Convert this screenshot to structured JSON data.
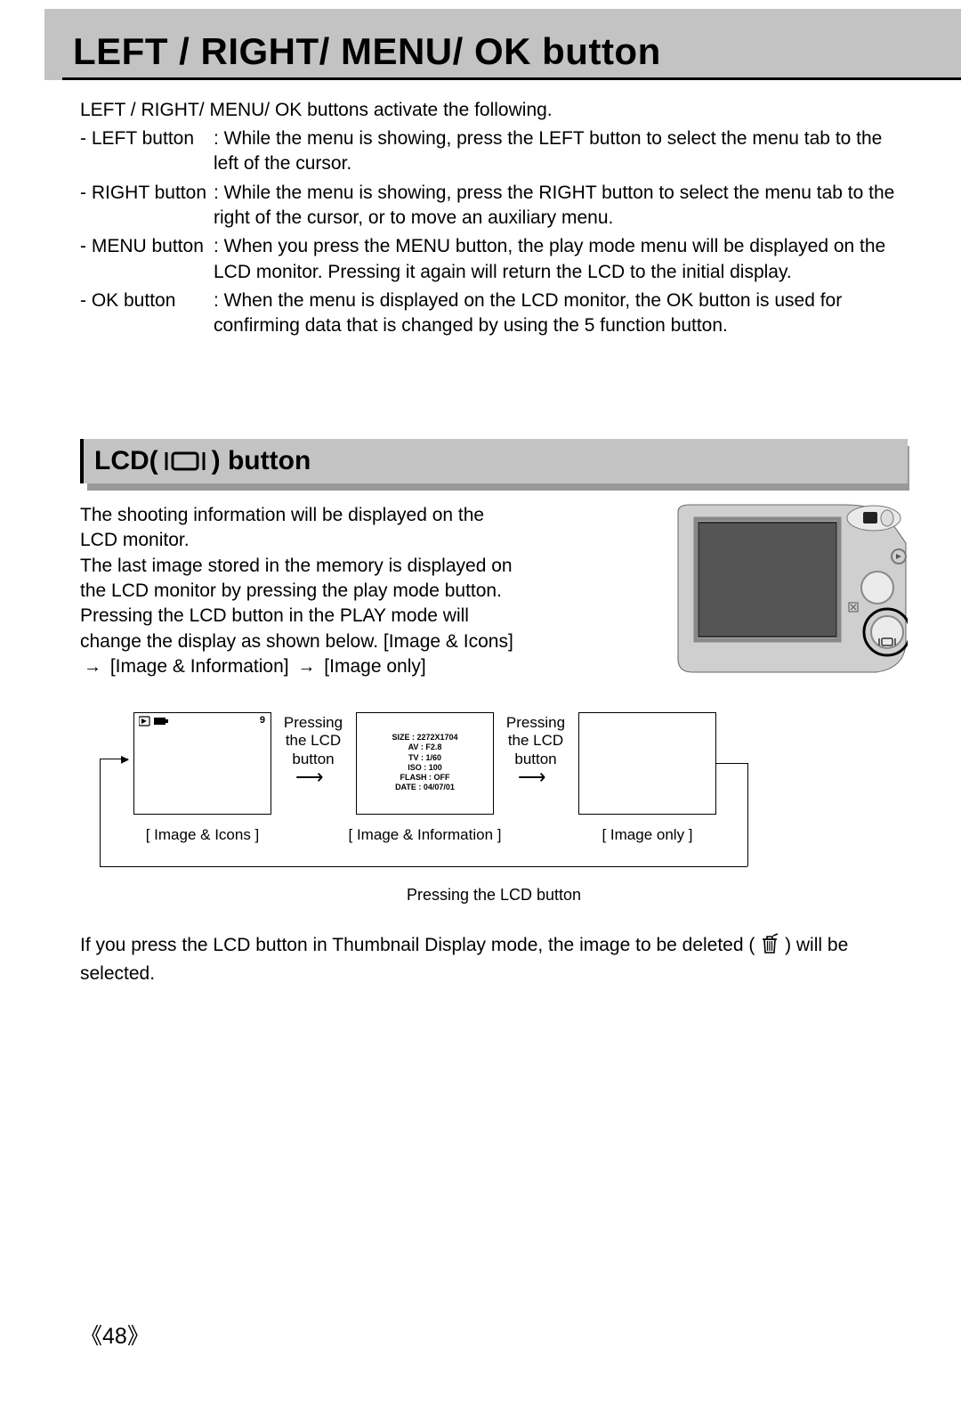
{
  "title": "LEFT / RIGHT/ MENU/ OK button",
  "intro": "LEFT / RIGHT/ MENU/ OK buttons activate the following.",
  "defs": [
    {
      "label": "- LEFT button",
      "desc": ": While the menu is showing, press the LEFT button to select the menu tab to the left of the cursor."
    },
    {
      "label": "- RIGHT button",
      "desc": ": While the menu is showing, press the RIGHT button to select the menu tab to the right of the cursor, or to move an auxiliary menu."
    },
    {
      "label": "- MENU button",
      "desc": ": When you press the MENU button, the play mode menu will be displayed on the LCD monitor. Pressing it again will return the LCD to the initial display."
    },
    {
      "label": "- OK button",
      "desc": ": When the menu is displayed on the LCD monitor, the OK button is used for confirming data that is changed by using the 5 function button."
    }
  ],
  "section2": {
    "prefix": "LCD(",
    "suffix": ") button",
    "icon_name": "lcd-icon"
  },
  "body2": {
    "p1": "The shooting information will be displayed on the LCD monitor.",
    "p2": "The last image stored in the memory is displayed on the LCD monitor by pressing the play mode button.",
    "p3a": "Pressing the LCD button in the PLAY mode will change the display as shown below. [Image & Icons]",
    "p3b": "[Image & Information]",
    "p3c": "[Image only]",
    "arrow": "→"
  },
  "diag": {
    "press_label": "Pressing the LCD button",
    "screens": [
      {
        "caption": "[ Image & Icons ]",
        "topright": "9"
      },
      {
        "caption": "[ Image & Information ]"
      },
      {
        "caption": "[ Image only ]"
      }
    ],
    "info": {
      "size": "SIZE : 2272X1704",
      "av": "AV : F2.8",
      "tv": "TV : 1/60",
      "iso": "ISO : 100",
      "flash": "FLASH : OFF",
      "date": "DATE : 04/07/01"
    },
    "bottom_label": "Pressing the LCD button"
  },
  "trailing": {
    "pre": "If you press the LCD button in Thumbnail Display mode, the image to be deleted (",
    "post": ") will be selected.",
    "icon_name": "trash-icon"
  },
  "page_num": "48"
}
